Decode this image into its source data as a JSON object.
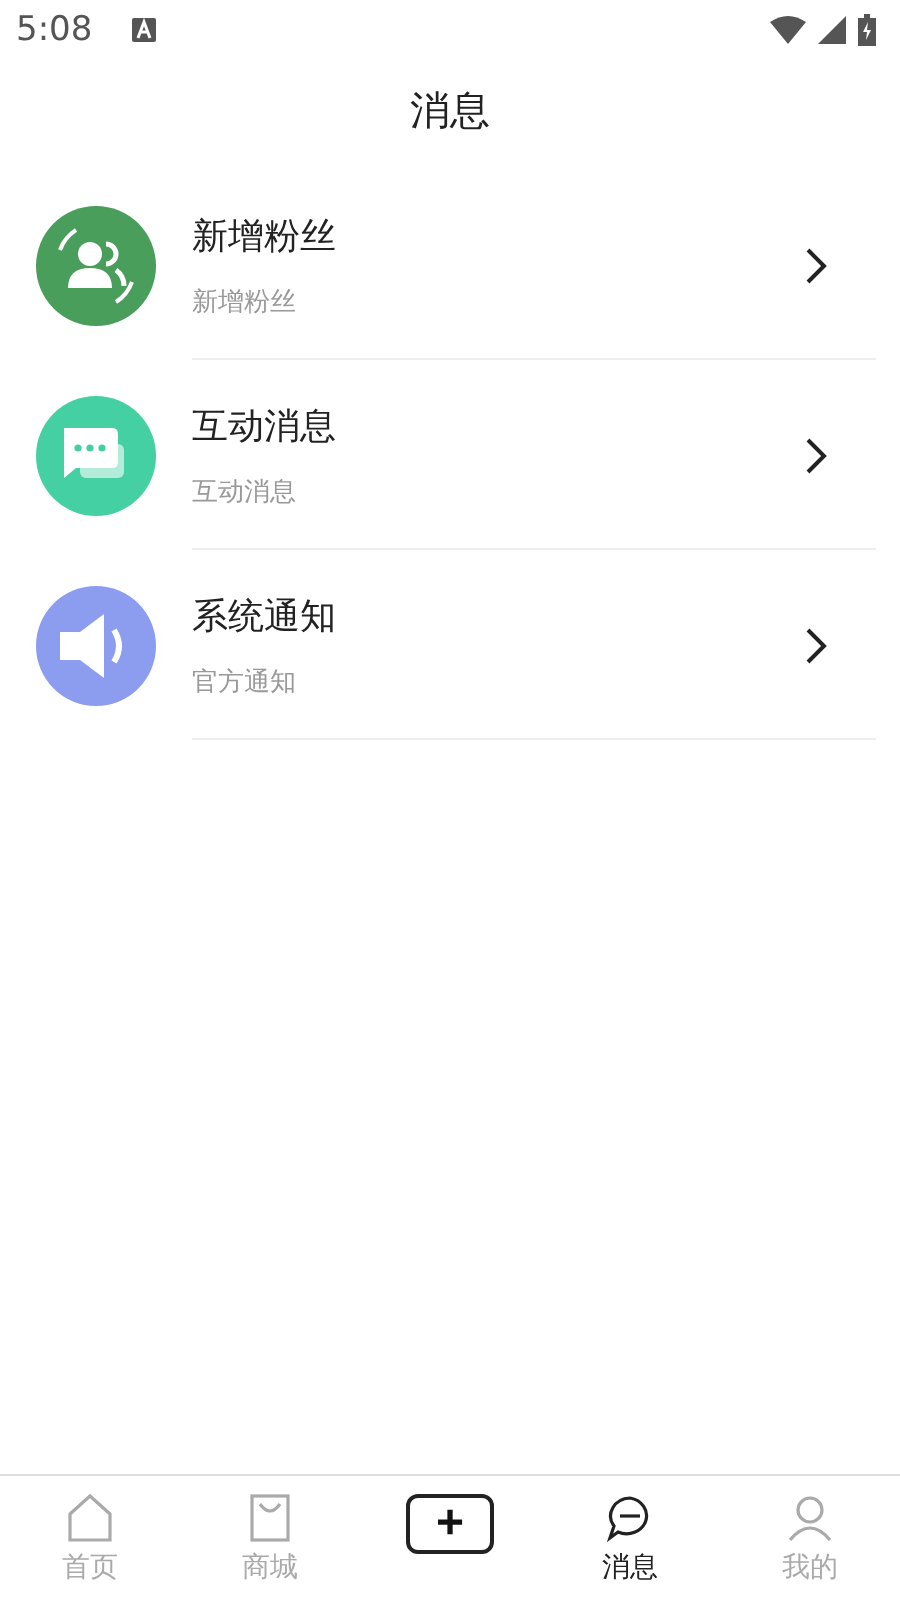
{
  "status_bar": {
    "time": "5:08"
  },
  "title": "消息",
  "messages": [
    {
      "title": "新增粉丝",
      "subtitle": "新增粉丝",
      "kind": "fans",
      "color": "#4a9e5c"
    },
    {
      "title": "互动消息",
      "subtitle": "互动消息",
      "kind": "chat",
      "color": "#45d0a3"
    },
    {
      "title": "系统通知",
      "subtitle": "官方通知",
      "kind": "speaker",
      "color": "#8c9df0"
    }
  ],
  "tab_bar": [
    {
      "kind": "home",
      "label": "首页",
      "selected": false
    },
    {
      "kind": "shop",
      "label": "商城",
      "selected": false
    },
    {
      "kind": "add",
      "label": "+"
    },
    {
      "kind": "message",
      "label": "消息",
      "selected": true
    },
    {
      "kind": "me",
      "label": "我的",
      "selected": false
    }
  ]
}
